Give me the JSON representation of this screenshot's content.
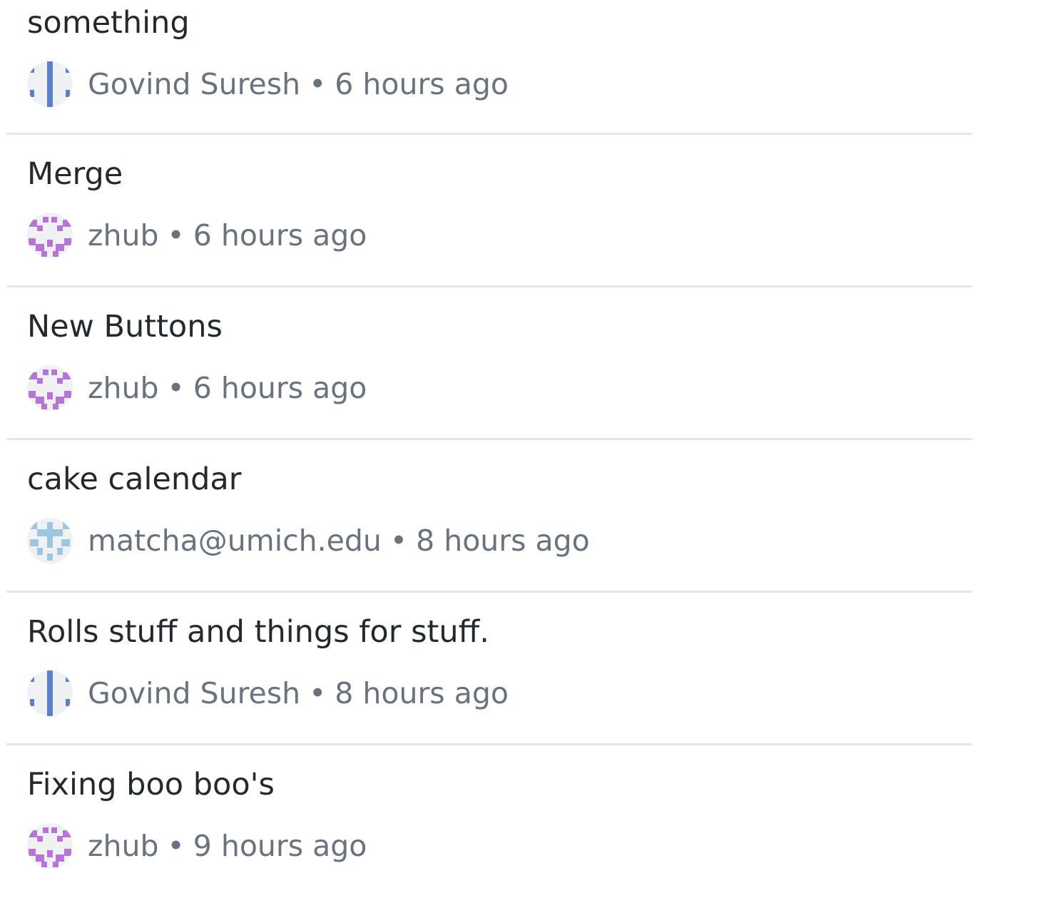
{
  "commits": [
    {
      "title": "something",
      "author": "Govind Suresh",
      "time": "6 hours ago",
      "avatar": "avatar-govind"
    },
    {
      "title": "Merge",
      "author": "zhub",
      "time": "6 hours ago",
      "avatar": "avatar-zhub"
    },
    {
      "title": "New Buttons",
      "author": "zhub",
      "time": "6 hours ago",
      "avatar": "avatar-zhub"
    },
    {
      "title": "cake calendar",
      "author": "matcha@umich.edu",
      "time": "8 hours ago",
      "avatar": "avatar-matcha"
    },
    {
      "title": "Rolls stuff and things for stuff.",
      "author": "Govind Suresh",
      "time": "8 hours ago",
      "avatar": "avatar-govind"
    },
    {
      "title": "Fixing boo boo's",
      "author": "zhub",
      "time": "9 hours ago",
      "avatar": "avatar-zhub"
    }
  ],
  "separator": "•",
  "colors": {
    "title": "#24292e",
    "meta": "#6a737d",
    "divider": "#e4e6e8",
    "avatar_bg": "#f0f1f3",
    "avatar_govind": "#5b80c7",
    "avatar_zhub": "#b574d6",
    "avatar_matcha": "#9ec6de"
  }
}
